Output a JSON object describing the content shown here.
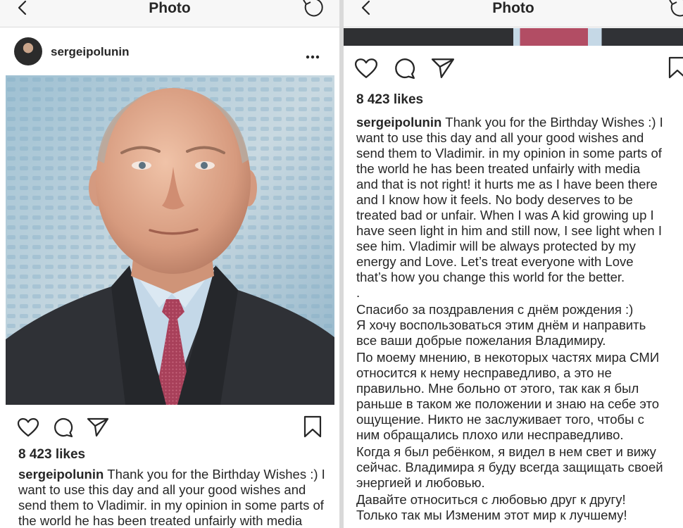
{
  "screen_title": "Photo",
  "post": {
    "username": "sergeipolunin",
    "likes": "8 423 likes"
  },
  "caption_en_lines": [
    "Thank you for the Birthday Wishes :) I",
    "want to use this day and all your good wishes and",
    "send them to Vladimir. in my opinion in some parts of",
    "the world he has been treated unfairly with media",
    "and that is not right!  it hurts me as I have been there",
    "and I know how it feels. No body deserves to be",
    "treated bad or unfair. When I was A kid growing up I",
    "have seen light in him and still now, I  see light when I",
    "see him. Vladimir will be always protected by my",
    "energy and Love. Let’s treat everyone with Love",
    "that’s how you change this world for the better."
  ],
  "caption_dot": ".",
  "caption_ru_lines": [
    "Спасибо за поздравления с днём рождения :)",
    "Я хочу воспользоваться этим днём и направить",
    "все ваши добрые пожелания Владимиру.",
    "По моему мнению, в некоторых частях  мира СМИ",
    "относится к нему несправедливо, а это не",
    "правильно. Мне больно от этого, так как я был",
    "раньше в таком же положении и знаю на себе это",
    "ощущение. Никто не заслуживает того, чтобы с",
    "ним обращались плохо или несправедливо.",
    "Когда я был ребёнком, я видел в нем свет и вижу",
    "сейчас. Владимира я буду всегда защищать своей",
    "энергией и любовью.",
    "Давайте относиться с любовью друг к другу!",
    "Только так мы Изменим этот мир к лучшему!"
  ],
  "icons": {
    "back": "chevron-left-icon",
    "refresh": "refresh-icon",
    "more": "more-horizontal-icon",
    "like": "heart-icon",
    "comment": "comment-icon",
    "share": "share-icon",
    "save": "bookmark-icon"
  },
  "colors": {
    "text": "#262626",
    "nav_background": "#f7f7f7",
    "border": "#dbdbdb"
  }
}
